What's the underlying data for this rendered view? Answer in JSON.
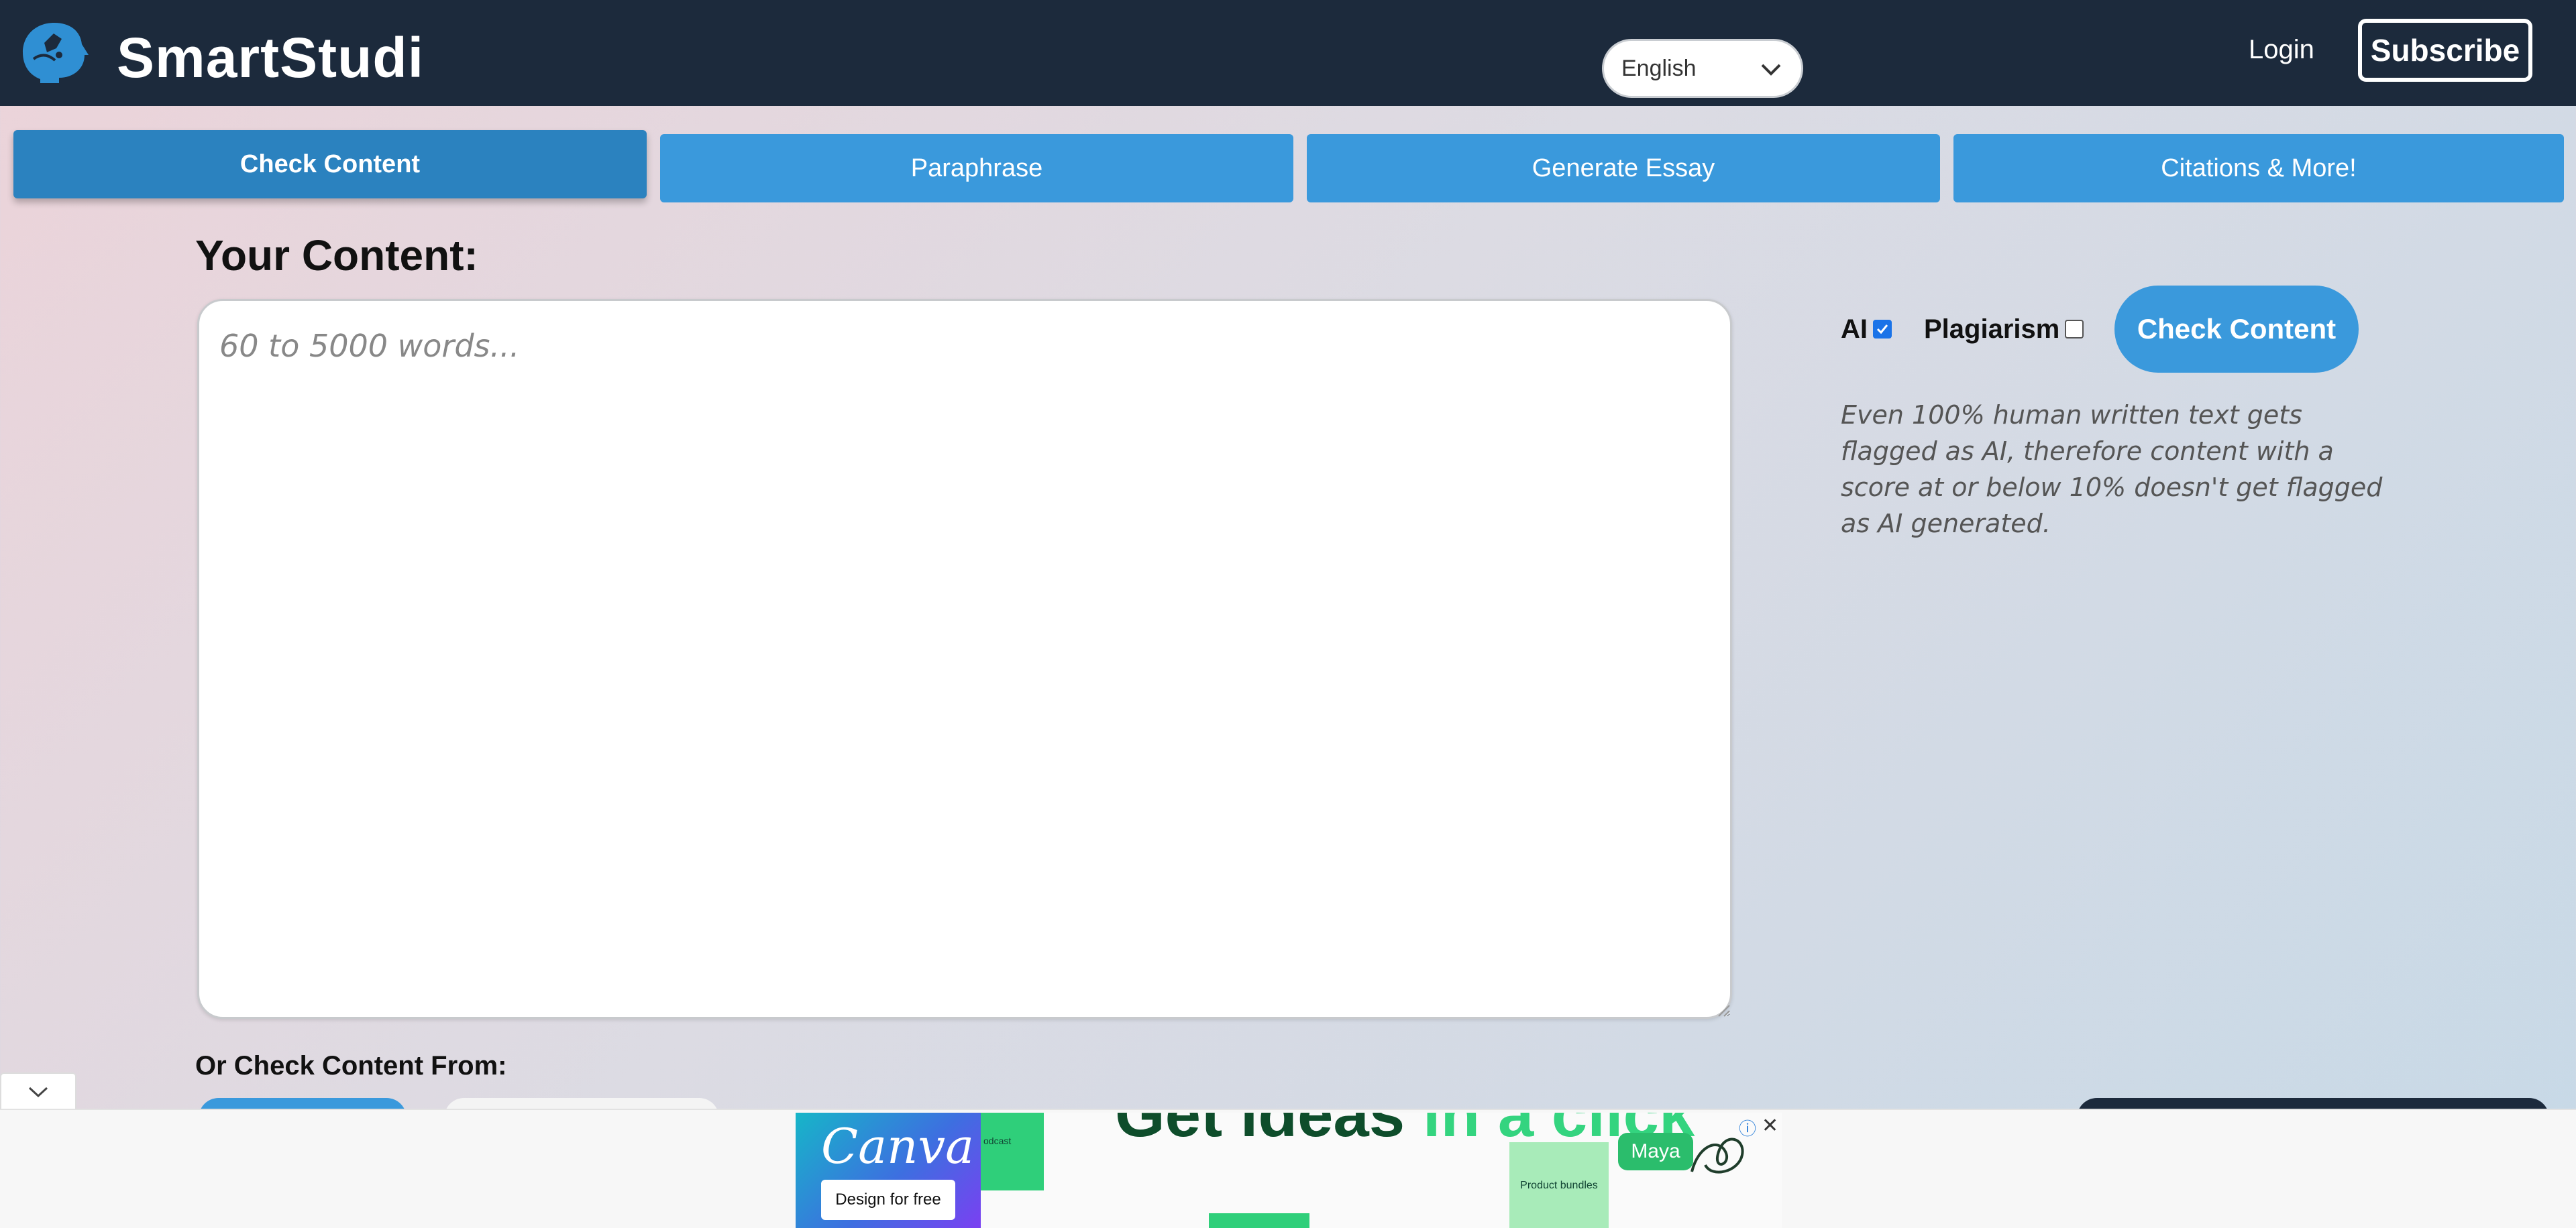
{
  "header": {
    "brand": "SmartStudi",
    "language": {
      "selected": "English"
    },
    "login_label": "Login",
    "subscribe_label": "Subscribe"
  },
  "tabs": [
    {
      "label": "Check Content",
      "active": true
    },
    {
      "label": "Paraphrase",
      "active": false
    },
    {
      "label": "Generate Essay",
      "active": false
    },
    {
      "label": "Citations & More!",
      "active": false
    }
  ],
  "content": {
    "title": "Your Content:",
    "placeholder": "60 to 5000 words...",
    "value": ""
  },
  "options": {
    "ai_label": "AI",
    "ai_checked": true,
    "plagiarism_label": "Plagiarism",
    "plagiarism_checked": false,
    "check_button_label": "Check Content",
    "note": "Even 100% human written text gets flagged as AI, therefore content with a score at or below 10% doesn't get flagged as AI generated."
  },
  "secondary": {
    "or_check_label": "Or Check Content From:"
  },
  "ad": {
    "canva_word": "Canva",
    "canva_cta": "Design for free",
    "podcast_label": "odcast",
    "headline_start": "Get ideas",
    "headline_end": " in a click",
    "bundle_label": "Product bundles",
    "maya_label": "Maya",
    "info_icon": "ⓘ",
    "close_icon": "✕"
  },
  "colors": {
    "header_bg": "#1c2a3c",
    "accent": "#3a99dc",
    "accent_active": "#2b82bf",
    "checkbox_on": "#1a73e8"
  }
}
